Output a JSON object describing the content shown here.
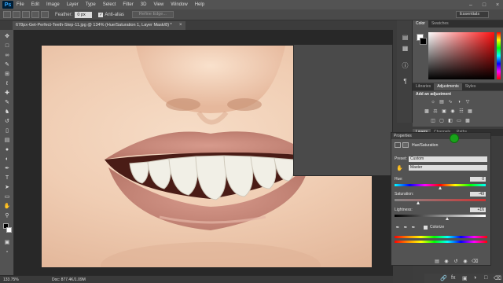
{
  "menubar": {
    "logo": "Ps",
    "items": [
      "File",
      "Edit",
      "Image",
      "Layer",
      "Type",
      "Select",
      "Filter",
      "3D",
      "View",
      "Window",
      "Help"
    ]
  },
  "options": {
    "feather_label": "Feather:",
    "feather_value": "0 px",
    "antialias_label": "Anti-alias",
    "refine_label": "Refine Edge...",
    "workspace": "Essentials"
  },
  "document": {
    "tab_title": "678px-Get-Perfect-Teeth-Step-11.jpg @ 134% (Hue/Saturation 1, Layer Mask/8) *"
  },
  "status": {
    "zoom": "133.75%",
    "doc_info": "Doc: 877.4K/1.09M"
  },
  "panels": {
    "color_tabs": [
      "Color",
      "Swatches"
    ],
    "adjust_tabs": [
      "Libraries",
      "Adjustments",
      "Styles"
    ],
    "adjust_hint": "Add an adjustment",
    "layers_tabs": [
      "Layers",
      "Channels",
      "Paths"
    ]
  },
  "properties": {
    "title": "Properties",
    "layer_name": "Hue/Saturation",
    "preset_label": "Preset:",
    "preset_value": "Custom",
    "channel_value": "Master",
    "hue_label": "Hue:",
    "hue_value": "0",
    "saturation_label": "Saturation:",
    "saturation_value": "-49",
    "lightness_label": "Lightness:",
    "lightness_value": "+16",
    "colorize_label": "Colorize",
    "hue_level": 0.5,
    "saturation_level": 0.255,
    "lightness_level": 0.58
  },
  "colors": {
    "accent_green": "#19a31a",
    "panel_bg": "#535353"
  }
}
